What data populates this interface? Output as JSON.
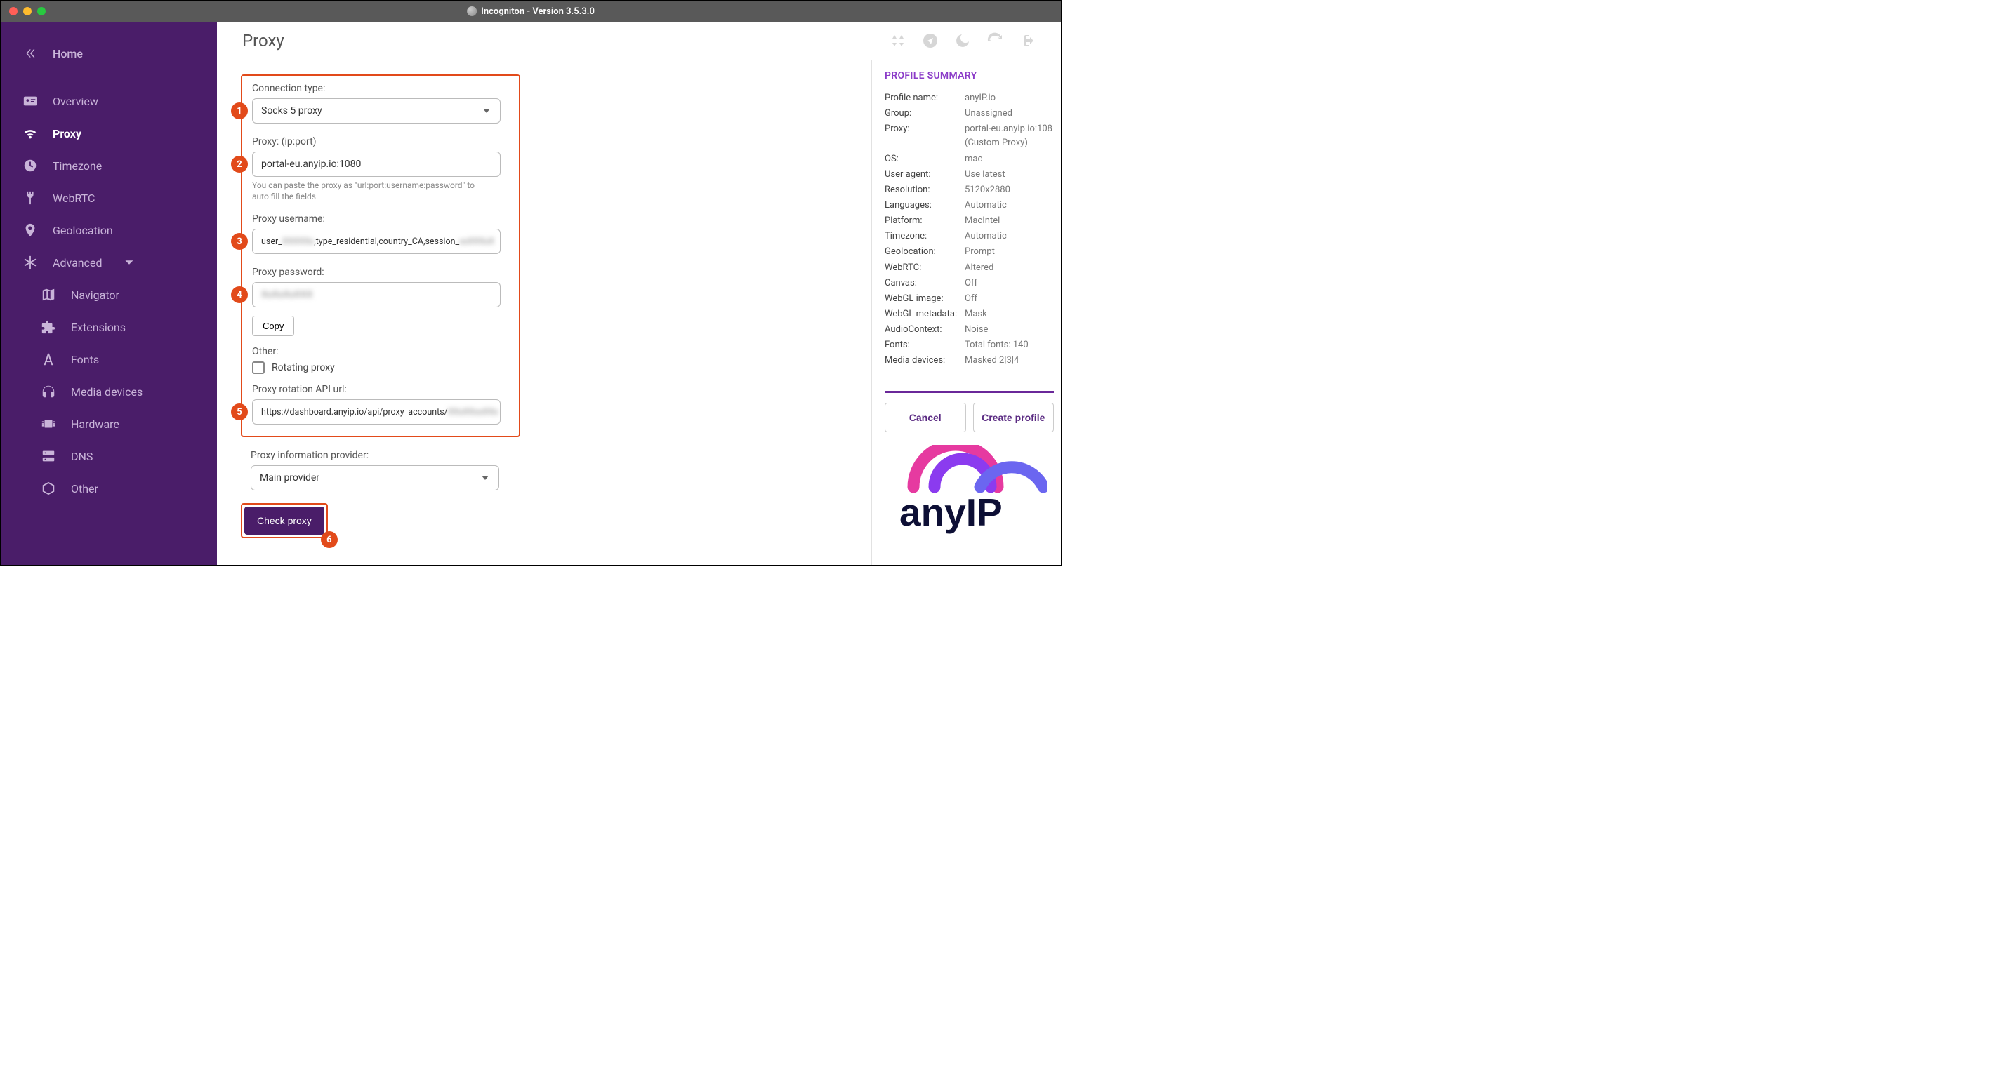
{
  "window": {
    "title": "Incogniton - Version 3.5.3.0"
  },
  "sidebar": {
    "home": "Home",
    "items": [
      {
        "label": "Overview"
      },
      {
        "label": "Proxy"
      },
      {
        "label": "Timezone"
      },
      {
        "label": "WebRTC"
      },
      {
        "label": "Geolocation"
      },
      {
        "label": "Advanced"
      }
    ],
    "advanced_items": [
      {
        "label": "Navigator"
      },
      {
        "label": "Extensions"
      },
      {
        "label": "Fonts"
      },
      {
        "label": "Media devices"
      },
      {
        "label": "Hardware"
      },
      {
        "label": "DNS"
      },
      {
        "label": "Other"
      }
    ]
  },
  "header": {
    "title": "Proxy"
  },
  "form": {
    "connection_type_label": "Connection type:",
    "connection_type_value": "Socks 5 proxy",
    "proxy_label": "Proxy: (ip:port)",
    "proxy_value": "portal-eu.anyip.io:1080",
    "proxy_hint": "You can paste the proxy as \"url:port:username:password\" to auto fill the fields.",
    "username_label": "Proxy username:",
    "username_prefix": "user_",
    "username_mid": ",type_residential,country_CA,session_",
    "username_blur1": "XXXXXx",
    "username_blur2": "xxXXXxX",
    "password_label": "Proxy password:",
    "password_blur": "XxXxXxXXX",
    "copy_label": "Copy",
    "other_label": "Other:",
    "rotating_label": "Rotating proxy",
    "rotation_url_label": "Proxy rotation API url:",
    "rotation_url_prefix": "https://dashboard.anyip.io/api/proxy_accounts/",
    "rotation_url_blur": "XXxXXxxXXx",
    "provider_label": "Proxy information provider:",
    "provider_value": "Main provider",
    "check_proxy_label": "Check proxy"
  },
  "badges": {
    "b1": "1",
    "b2": "2",
    "b3": "3",
    "b4": "4",
    "b5": "5",
    "b6": "6"
  },
  "summary": {
    "title": "PROFILE SUMMARY",
    "rows": [
      {
        "lab": "Profile name:",
        "val": "anyIP.io"
      },
      {
        "lab": "Group:",
        "val": "Unassigned"
      },
      {
        "lab": "Proxy:",
        "val": "portal-eu.anyip.io:108 (Custom Proxy)"
      },
      {
        "lab": "OS:",
        "val": "mac"
      },
      {
        "lab": "User agent:",
        "val": "Use latest"
      },
      {
        "lab": "Resolution:",
        "val": "5120x2880"
      },
      {
        "lab": "Languages:",
        "val": "Automatic"
      },
      {
        "lab": "Platform:",
        "val": "MacIntel"
      },
      {
        "lab": "Timezone:",
        "val": "Automatic"
      },
      {
        "lab": "Geolocation:",
        "val": "Prompt"
      },
      {
        "lab": "WebRTC:",
        "val": "Altered"
      },
      {
        "lab": "Canvas:",
        "val": "Off"
      },
      {
        "lab": "WebGL image:",
        "val": "Off"
      },
      {
        "lab": "WebGL metadata:",
        "val": "Mask"
      },
      {
        "lab": "AudioContext:",
        "val": "Noise"
      },
      {
        "lab": "Fonts:",
        "val": "Total fonts: 140"
      },
      {
        "lab": "Media devices:",
        "val": "Masked 2|3|4"
      }
    ],
    "cancel": "Cancel",
    "create": "Create profile"
  }
}
